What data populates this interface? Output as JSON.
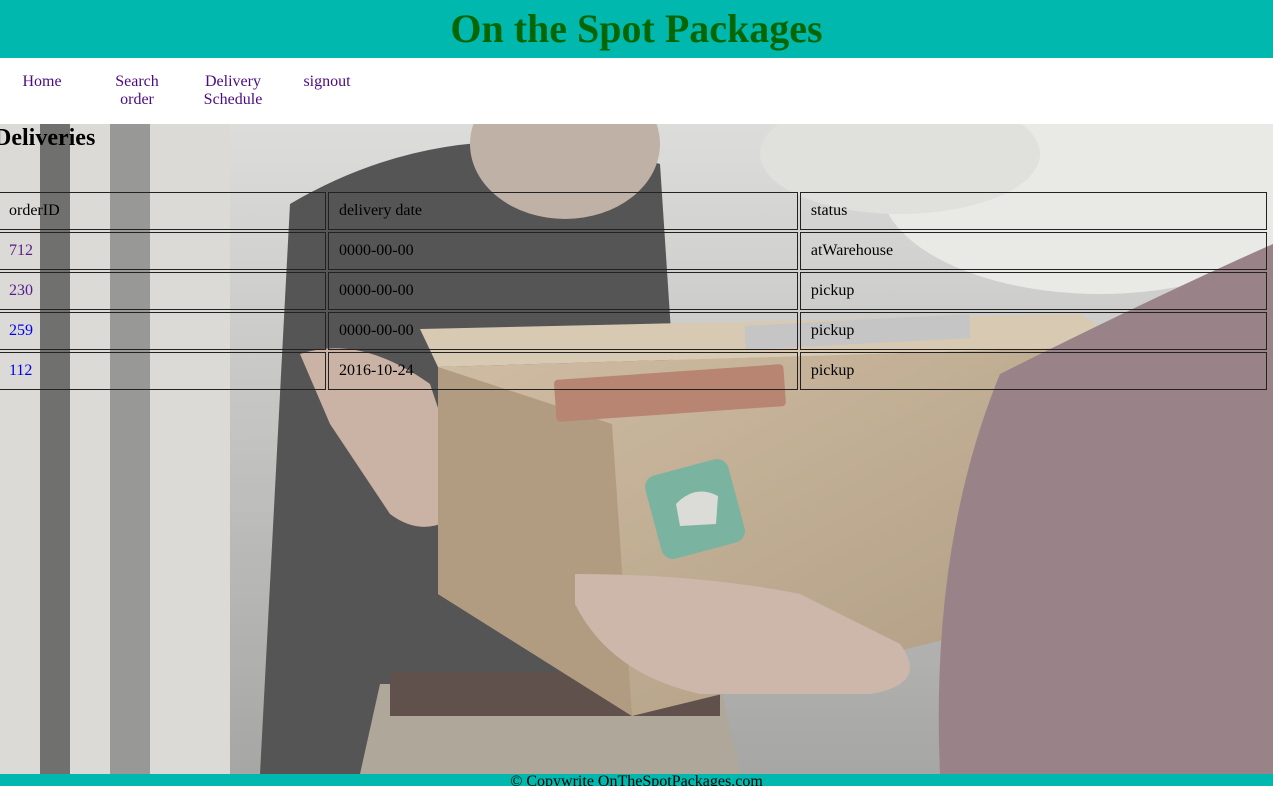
{
  "header": {
    "title": "On the Spot Packages"
  },
  "nav": {
    "items": [
      {
        "label": "Home"
      },
      {
        "label": "Search order"
      },
      {
        "label": "Delivery Schedule"
      },
      {
        "label": "signout"
      }
    ]
  },
  "main": {
    "title": "Deliveries",
    "table": {
      "columns": [
        "orderID",
        "delivery date",
        "status"
      ],
      "rows": [
        {
          "orderID": "712",
          "date": "0000-00-00",
          "status": "atWarehouse",
          "link_color": "#551a8b"
        },
        {
          "orderID": "230",
          "date": "0000-00-00",
          "status": "pickup",
          "link_color": "#551a8b"
        },
        {
          "orderID": "259",
          "date": "0000-00-00",
          "status": "pickup",
          "link_color": "#0000ee"
        },
        {
          "orderID": "112",
          "date": "2016-10-24",
          "status": "pickup",
          "link_color": "#0000ee"
        }
      ]
    }
  },
  "footer": {
    "text": "© Copywrite OnTheSpotPackages.com"
  },
  "colors": {
    "header_bg": "#00b8ad",
    "title_color": "#056605",
    "nav_link": "#4b0b82",
    "visited_link": "#551a8b",
    "unvisited_link": "#0000ee"
  }
}
